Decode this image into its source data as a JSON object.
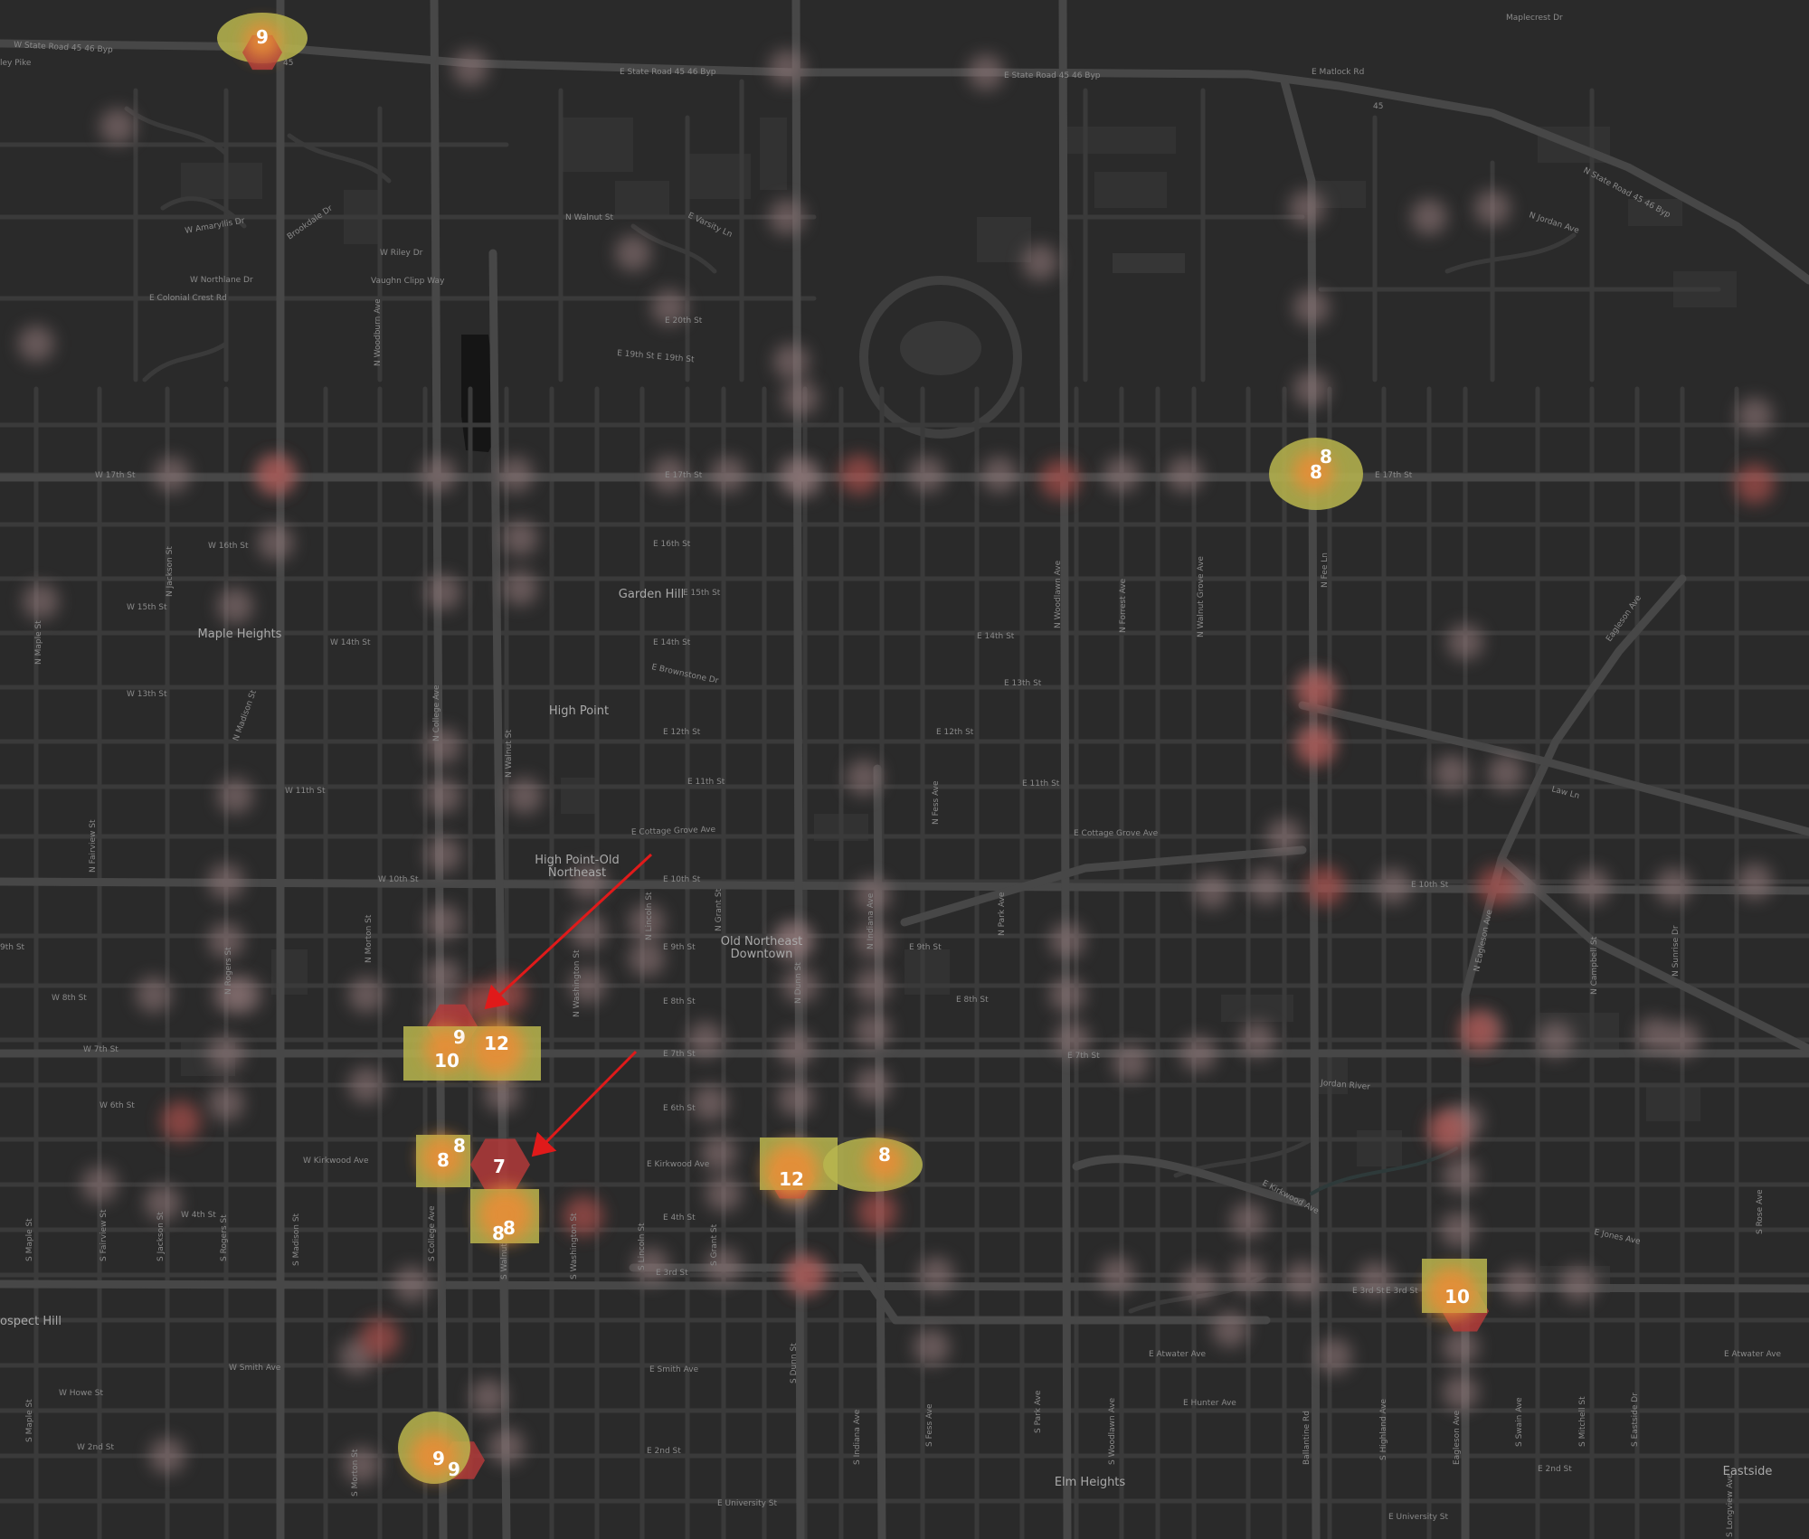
{
  "colors": {
    "background": "#2a2a2a",
    "road_major": "#4a4a4a",
    "road_minor": "#3b3b3b",
    "block": "#333333",
    "glow": "#9a7f80",
    "glow_hot": "#b5534f",
    "hex_yellow": "#b8b64f",
    "hex_orange": "#e58e37",
    "hex_red": "#b23a3a",
    "arrow": "#e01a1a"
  },
  "neighborhoods": [
    {
      "id": "maple-heights",
      "label": "Maple Heights",
      "lines": [
        "Maple Heights"
      ]
    },
    {
      "id": "garden-hill",
      "label": "Garden Hill",
      "lines": [
        "Garden Hill"
      ]
    },
    {
      "id": "high-point",
      "label": "High Point",
      "lines": [
        "High Point"
      ]
    },
    {
      "id": "high-point-old-northeast",
      "label": "High Point-Old Northeast",
      "lines": [
        "High Point-Old",
        "Northeast"
      ]
    },
    {
      "id": "old-northeast-downtown",
      "label": "Old Northeast Downtown",
      "lines": [
        "Old Northeast",
        "Downtown"
      ]
    },
    {
      "id": "prospect-hill",
      "label": "ospect Hill",
      "lines": [
        "ospect Hill"
      ]
    },
    {
      "id": "elm-heights",
      "label": "Elm Heights",
      "lines": [
        "Elm Heights"
      ]
    },
    {
      "id": "eastside",
      "label": "Eastside",
      "lines": [
        "Eastside"
      ]
    }
  ],
  "streets": [
    {
      "id": "w-state-road-45-46-byp",
      "label": "W State Road 45 46 Byp"
    },
    {
      "id": "ley-pike",
      "label": "ley Pike"
    },
    {
      "id": "e-state-road-45-46-byp-1",
      "label": "E State Road 45 46 Byp"
    },
    {
      "id": "e-state-road-45-46-byp-2",
      "label": "E State Road 45 46 Byp"
    },
    {
      "id": "e-matlock-rd",
      "label": "E Matlock Rd"
    },
    {
      "id": "maplecrest-dr",
      "label": "Maplecrest Dr"
    },
    {
      "id": "n-state-road-45-46-byp",
      "label": "N State Road 45 46 Byp"
    },
    {
      "id": "n-jordan-ave",
      "label": "N Jordan Ave"
    },
    {
      "id": "w-amaryllis-dr",
      "label": "W Amaryllis Dr"
    },
    {
      "id": "brookdale-dr",
      "label": "Brookdale Dr"
    },
    {
      "id": "w-riley-dr",
      "label": "W Riley Dr"
    },
    {
      "id": "w-northlane-dr",
      "label": "W Northlane Dr"
    },
    {
      "id": "vaughn-clipp-way",
      "label": "Vaughn Clipp Way"
    },
    {
      "id": "e-colonial-crest-rd",
      "label": "E Colonial Crest Rd"
    },
    {
      "id": "n-walnut-st-top",
      "label": "N Walnut St"
    },
    {
      "id": "e-varsity-ln",
      "label": "E Varsity Ln"
    },
    {
      "id": "e-20th-st",
      "label": "E 20th St"
    },
    {
      "id": "e-19th-st",
      "label": "E 19th St  E 19th St"
    },
    {
      "id": "w-17th-st",
      "label": "W 17th St"
    },
    {
      "id": "e-17th-st-1",
      "label": "E 17th St"
    },
    {
      "id": "e-17th-st-2",
      "label": "E 17th St"
    },
    {
      "id": "e-16th-st",
      "label": "E 16th St"
    },
    {
      "id": "w-16th-st",
      "label": "W 16th St"
    },
    {
      "id": "e-15th-st",
      "label": "E 15th St"
    },
    {
      "id": "w-15th-st",
      "label": "W 15th St"
    },
    {
      "id": "e-14th-st",
      "label": "E 14th St"
    },
    {
      "id": "e-14th-st-2",
      "label": "E 14th St"
    },
    {
      "id": "w-14th-st",
      "label": "W 14th St"
    },
    {
      "id": "e-brownstone-dr",
      "label": "E Brownstone Dr"
    },
    {
      "id": "e-13th-st",
      "label": "E 13th St"
    },
    {
      "id": "w-13th-st",
      "label": "W 13th St"
    },
    {
      "id": "e-12th-st",
      "label": "E 12th St"
    },
    {
      "id": "e-12th-st-2",
      "label": "E 12th St"
    },
    {
      "id": "e-11th-st",
      "label": "E 11th St"
    },
    {
      "id": "e-11th-st-2",
      "label": "E 11th St"
    },
    {
      "id": "w-11th-st",
      "label": "W 11th St"
    },
    {
      "id": "e-cottage-grove-ave",
      "label": "E Cottage Grove Ave"
    },
    {
      "id": "e-cottage-grove-ave-2",
      "label": "E Cottage Grove Ave"
    },
    {
      "id": "e-10th-st",
      "label": "E 10th St"
    },
    {
      "id": "e-10th-st-2",
      "label": "E 10th St"
    },
    {
      "id": "w-10th-st",
      "label": "W 10th St"
    },
    {
      "id": "e-9th-st",
      "label": "E 9th St"
    },
    {
      "id": "e-9th-st-2",
      "label": "E 9th St"
    },
    {
      "id": "w-9th-st",
      "label": "9th St"
    },
    {
      "id": "e-8th-st",
      "label": "E 8th St"
    },
    {
      "id": "e-8th-st-2",
      "label": "E 8th St"
    },
    {
      "id": "w-8th-st",
      "label": "W 8th St"
    },
    {
      "id": "e-7th-st",
      "label": "E 7th St"
    },
    {
      "id": "e-7th-st-2",
      "label": "E 7th St"
    },
    {
      "id": "w-7th-st",
      "label": "W 7th St"
    },
    {
      "id": "e-6th-st",
      "label": "E 6th St"
    },
    {
      "id": "w-6th-st",
      "label": "W 6th St"
    },
    {
      "id": "e-kirkwood-ave",
      "label": "E Kirkwood Ave"
    },
    {
      "id": "e-kirkwood-ave-2",
      "label": "E Kirkwood Ave"
    },
    {
      "id": "w-kirkwood-ave",
      "label": "W Kirkwood Ave"
    },
    {
      "id": "e-4th-st",
      "label": "E 4th St"
    },
    {
      "id": "w-4th-st",
      "label": "W 4th St"
    },
    {
      "id": "e-jones-ave",
      "label": "E Jones Ave"
    },
    {
      "id": "e-3rd-st",
      "label": "E 3rd St"
    },
    {
      "id": "e-3rd-st-2",
      "label": "E 3rd St"
    },
    {
      "id": "e-3rd-st-3",
      "label": "E 3rd St"
    },
    {
      "id": "e-atwater-ave",
      "label": "E Atwater Ave"
    },
    {
      "id": "e-atwater-ave-2",
      "label": "E Atwater Ave"
    },
    {
      "id": "e-smith-ave",
      "label": "E Smith Ave"
    },
    {
      "id": "w-smith-ave",
      "label": "W Smith Ave"
    },
    {
      "id": "w-howe-st",
      "label": "W Howe St"
    },
    {
      "id": "e-hunter-ave",
      "label": "E Hunter Ave"
    },
    {
      "id": "e-2nd-st",
      "label": "E 2nd St"
    },
    {
      "id": "e-2nd-st-2",
      "label": "E 2nd St"
    },
    {
      "id": "w-2nd-st",
      "label": "W 2nd St"
    },
    {
      "id": "e-university-st",
      "label": "E University St"
    },
    {
      "id": "e-university-st-2",
      "label": "E University St"
    },
    {
      "id": "law-ln",
      "label": "Law Ln"
    },
    {
      "id": "eagleson-ave-ne",
      "label": "Eagleson Ave"
    },
    {
      "id": "n-college-ave",
      "label": "N College Ave"
    },
    {
      "id": "n-walnut-st",
      "label": "N Walnut St"
    },
    {
      "id": "n-dunn-st",
      "label": "N Dunn St"
    },
    {
      "id": "n-lincoln-st",
      "label": "N Lincoln St"
    },
    {
      "id": "n-grant-st",
      "label": "N Grant St"
    },
    {
      "id": "n-indiana-ave",
      "label": "N Indiana Ave"
    },
    {
      "id": "n-fess-ave",
      "label": "N Fess Ave"
    },
    {
      "id": "n-park-ave",
      "label": "N Park Ave"
    },
    {
      "id": "n-woodlawn-ave",
      "label": "N Woodlawn Ave"
    },
    {
      "id": "n-forrest-ave",
      "label": "N Forrest Ave"
    },
    {
      "id": "n-walnut-grove-ave",
      "label": "N Walnut Grove Ave"
    },
    {
      "id": "n-fee-ln",
      "label": "N Fee Ln"
    },
    {
      "id": "n-eagleson-ave",
      "label": "N Eagleson Ave"
    },
    {
      "id": "n-campbell-st",
      "label": "N Campbell St"
    },
    {
      "id": "n-sunrise-dr",
      "label": "N Sunrise Dr"
    },
    {
      "id": "n-jackson-st",
      "label": "N Jackson St"
    },
    {
      "id": "n-madison-st",
      "label": "N Madison St"
    },
    {
      "id": "n-rogers-st",
      "label": "N Rogers St"
    },
    {
      "id": "n-morton-st",
      "label": "N Morton St"
    },
    {
      "id": "n-maple-st",
      "label": "N Maple St"
    },
    {
      "id": "n-fairview-st",
      "label": "N Fairview St"
    },
    {
      "id": "n-woodburn-ave",
      "label": "N Woodburn Ave"
    },
    {
      "id": "n-washington-st",
      "label": "N Washington St"
    },
    {
      "id": "s-college-ave",
      "label": "S College Ave"
    },
    {
      "id": "s-walnut-st",
      "label": "S Walnut St"
    },
    {
      "id": "s-washington-st",
      "label": "S Washington St"
    },
    {
      "id": "s-lincoln-st",
      "label": "S Lincoln St"
    },
    {
      "id": "s-grant-st",
      "label": "S Grant St"
    },
    {
      "id": "s-dunn-st",
      "label": "S Dunn St"
    },
    {
      "id": "s-indiana-ave",
      "label": "S Indiana Ave"
    },
    {
      "id": "s-fess-ave",
      "label": "S Fess Ave"
    },
    {
      "id": "s-park-ave",
      "label": "S Park Ave"
    },
    {
      "id": "s-woodlawn-ave",
      "label": "S Woodlawn Ave"
    },
    {
      "id": "s-highland-ave",
      "label": "S Highland Ave"
    },
    {
      "id": "s-swain-ave",
      "label": "S Swain Ave"
    },
    {
      "id": "s-mitchell-st",
      "label": "S Mitchell St"
    },
    {
      "id": "s-eastside-dr",
      "label": "S Eastside Dr"
    },
    {
      "id": "s-rose-ave",
      "label": "S Rose Ave"
    },
    {
      "id": "s-rogers-st",
      "label": "S Rogers St"
    },
    {
      "id": "s-madison-st",
      "label": "S Madison St"
    },
    {
      "id": "s-maple-st",
      "label": "S Maple St"
    },
    {
      "id": "s-fairview-st",
      "label": "S Fairview St"
    },
    {
      "id": "s-jackson-st",
      "label": "S Jackson St"
    },
    {
      "id": "s-morton-st",
      "label": "S Morton St"
    },
    {
      "id": "s-maple-st-2",
      "label": "S Maple St"
    },
    {
      "id": "ballantine-rd",
      "label": "Ballantine Rd"
    },
    {
      "id": "eagleson-ave-s",
      "label": "Eagleson Ave"
    },
    {
      "id": "longview-ave",
      "label": "S Longview Ave"
    },
    {
      "id": "jordan-river",
      "label": "Jordan River"
    },
    {
      "id": "road-45-shield",
      "label": "45"
    },
    {
      "id": "road-45-shield-2",
      "label": "45"
    }
  ],
  "clusters": [
    {
      "id": "c1",
      "counts": [
        "9"
      ],
      "colors": [
        "yellow",
        "orange",
        "red"
      ]
    },
    {
      "id": "c2",
      "counts": [
        "8",
        "8"
      ],
      "colors": [
        "yellow",
        "orange"
      ]
    },
    {
      "id": "c3",
      "counts": [
        "9",
        "10"
      ],
      "colors": [
        "red",
        "yellow",
        "orange"
      ]
    },
    {
      "id": "c4",
      "counts": [
        "12"
      ],
      "colors": [
        "yellow",
        "orange"
      ]
    },
    {
      "id": "c5",
      "counts": [
        "8",
        "8"
      ],
      "colors": [
        "yellow",
        "orange"
      ]
    },
    {
      "id": "c6",
      "counts": [
        "7"
      ],
      "colors": [
        "red"
      ]
    },
    {
      "id": "c7",
      "counts": [
        "8",
        "8"
      ],
      "colors": [
        "yellow",
        "orange"
      ]
    },
    {
      "id": "c8",
      "counts": [
        "12"
      ],
      "colors": [
        "yellow",
        "orange",
        "red"
      ]
    },
    {
      "id": "c9",
      "counts": [
        "8"
      ],
      "colors": [
        "yellow",
        "orange"
      ]
    },
    {
      "id": "c10",
      "counts": [
        "10"
      ],
      "colors": [
        "yellow",
        "orange",
        "red"
      ]
    },
    {
      "id": "c11",
      "counts": [
        "9",
        "9"
      ],
      "colors": [
        "yellow",
        "orange",
        "red"
      ]
    }
  ],
  "annotations": [
    {
      "id": "arrow-1",
      "type": "arrow",
      "color": "#e01a1a"
    },
    {
      "id": "arrow-2",
      "type": "arrow",
      "color": "#e01a1a"
    }
  ]
}
